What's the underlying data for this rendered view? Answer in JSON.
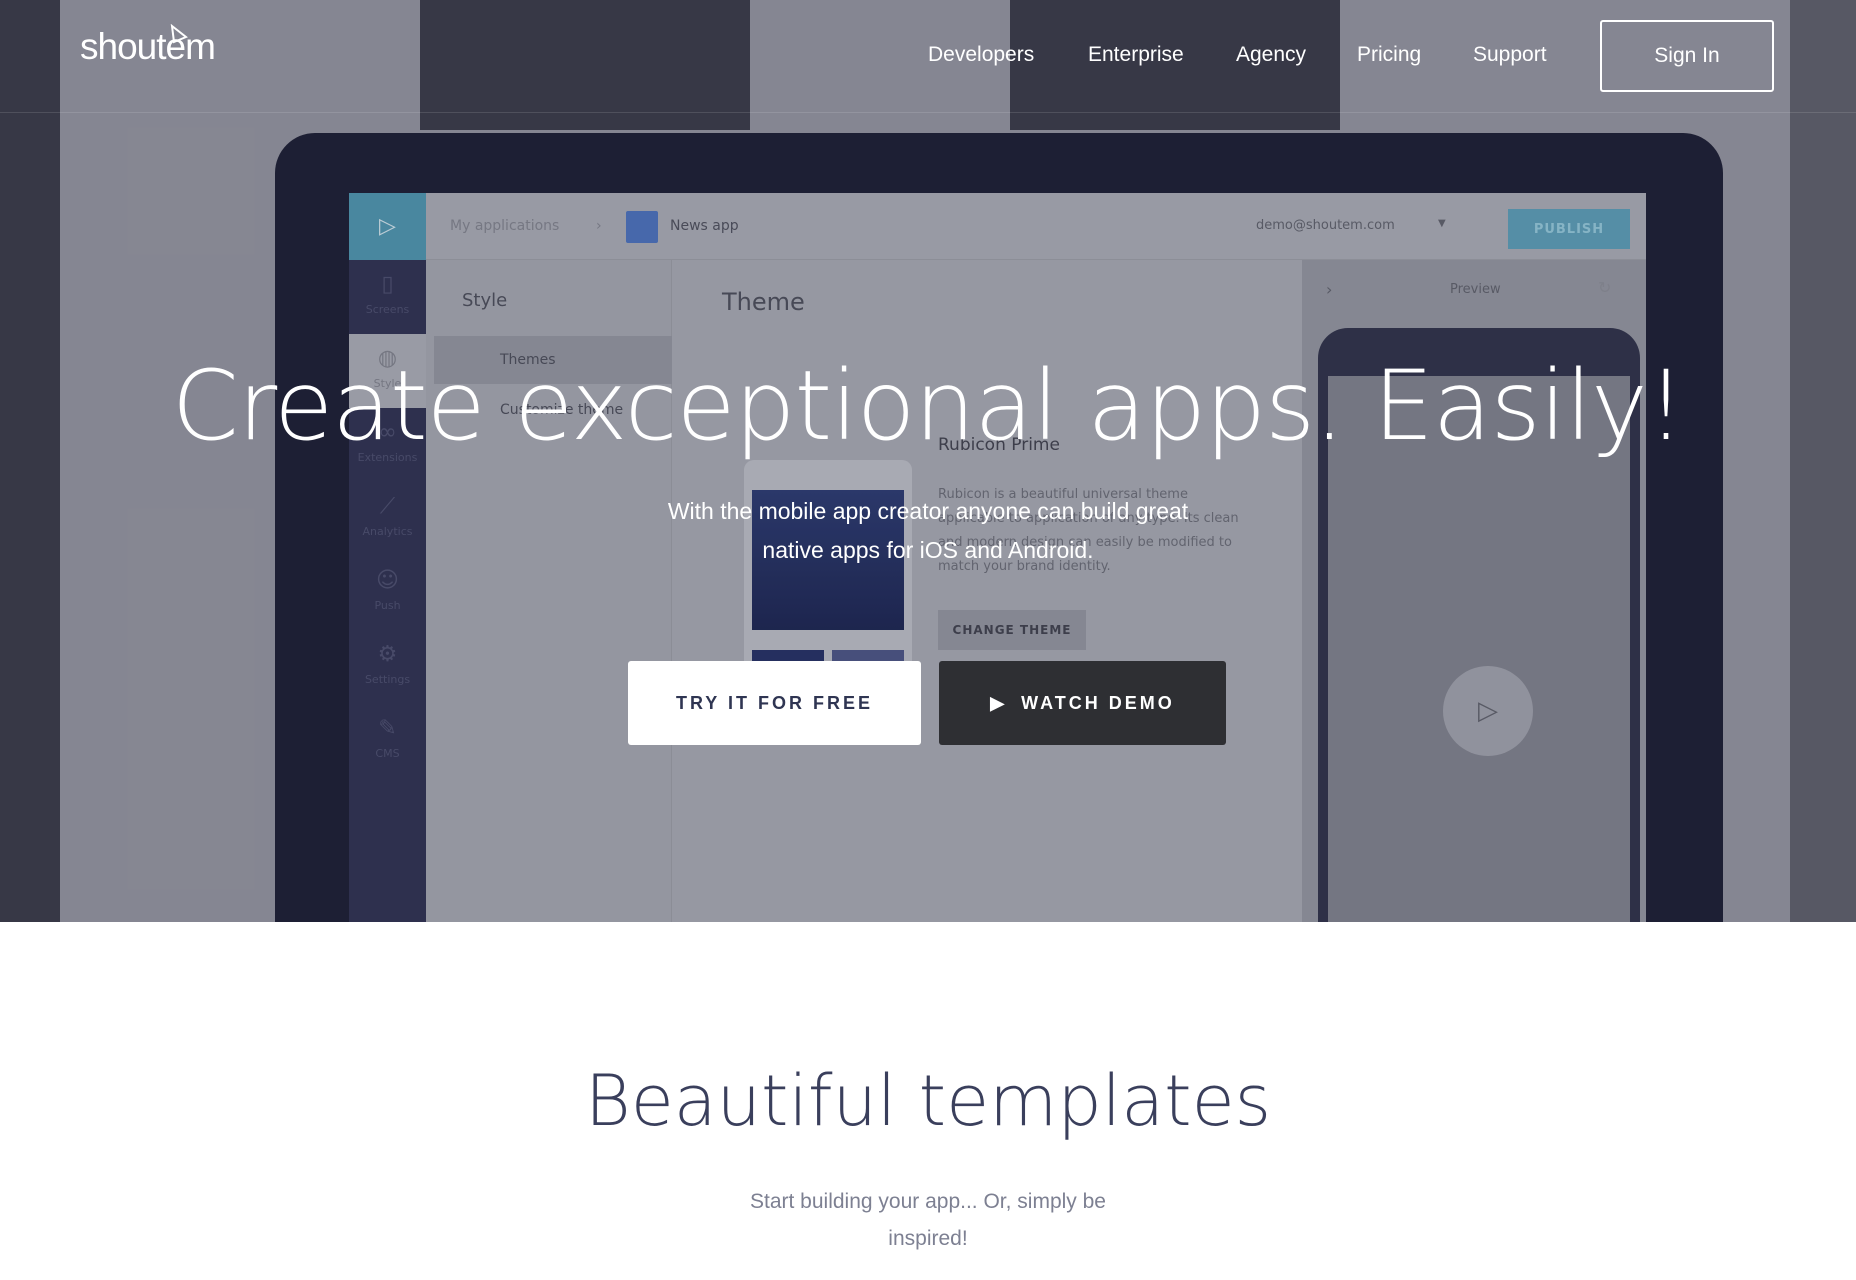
{
  "header": {
    "logo": "shoutem",
    "nav": [
      "Developers",
      "Enterprise",
      "Agency",
      "Pricing",
      "Support"
    ],
    "sign_in": "Sign In"
  },
  "hero": {
    "title": "Create exceptional apps. Easily!",
    "subtitle_line1": "With the mobile app creator anyone can build great",
    "subtitle_line2": "native apps for iOS and Android.",
    "try_button": "TRY IT FOR FREE",
    "demo_button": "WATCH DEMO"
  },
  "mockup": {
    "breadcrumb_root": "My applications",
    "app_name": "News app",
    "user_email": "demo@shoutem.com",
    "publish": "PUBLISH",
    "sidebar": [
      "Screens",
      "Style",
      "Extensions",
      "Analytics",
      "Push",
      "Settings",
      "CMS"
    ],
    "style_heading": "Style",
    "style_items": [
      "Themes",
      "Customize theme"
    ],
    "theme_heading": "Theme",
    "theme_name": "Rubicon Prime",
    "theme_desc": "Rubicon is a beautiful universal theme applicable to application of any type. Its clean and modern design can easily be modified to match your brand identity.",
    "change_theme": "CHANGE THEME",
    "preview": "Preview"
  },
  "templates": {
    "title": "Beautiful templates",
    "subtitle_line1": "Start building your app... Or, simply be",
    "subtitle_line2": "inspired!"
  },
  "colors": {
    "accent": "#5a97af",
    "dark_button": "#2e2f33",
    "title": "#3a3f5c"
  }
}
